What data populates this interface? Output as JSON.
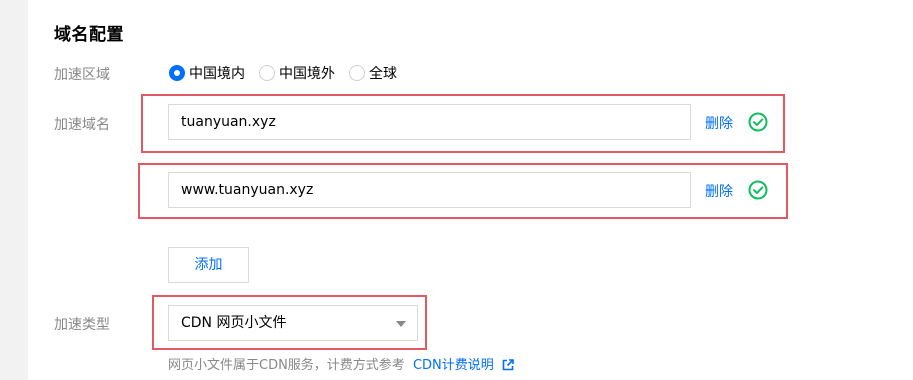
{
  "section": {
    "title": "域名配置"
  },
  "region": {
    "label": "加速区域",
    "options": [
      {
        "label": "中国境内",
        "checked": true
      },
      {
        "label": "中国境外",
        "checked": false
      },
      {
        "label": "全球",
        "checked": false
      }
    ]
  },
  "domains": {
    "label": "加速域名",
    "items": [
      {
        "value": "tuanyuan.xyz",
        "delete_label": "删除",
        "status_icon": "check-circle-icon"
      },
      {
        "value": "www.tuanyuan.xyz",
        "delete_label": "删除",
        "status_icon": "check-circle-icon"
      }
    ],
    "add_label": "添加"
  },
  "accel_type": {
    "label": "加速类型",
    "selected": "CDN 网页小文件",
    "help_text": "网页小文件属于CDN服务，计费方式参考",
    "help_link": "CDN计费说明",
    "help_link_icon": "external-link-icon"
  },
  "colors": {
    "accent": "#006eff",
    "success": "#0abf5b",
    "highlight": "#e05a63",
    "muted_text": "#888888"
  }
}
